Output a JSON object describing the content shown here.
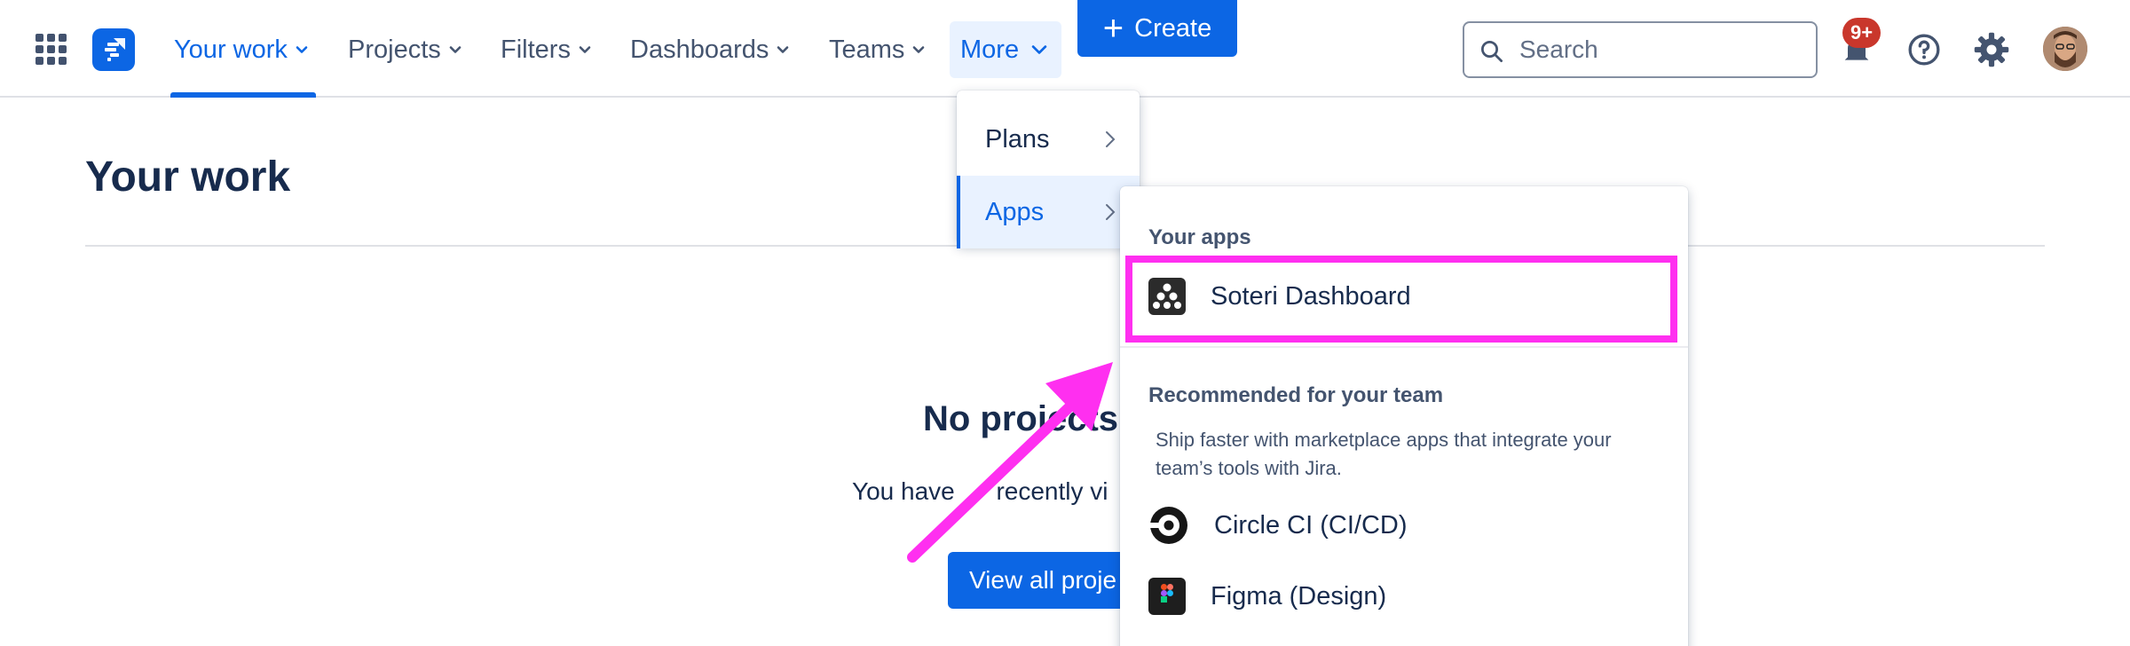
{
  "nav": {
    "your_work": "Your work",
    "projects": "Projects",
    "filters": "Filters",
    "dashboards": "Dashboards",
    "teams": "Teams",
    "more": "More",
    "create": "Create",
    "create_icon": "plus-icon"
  },
  "search": {
    "placeholder": "Search"
  },
  "notifications": {
    "badge": "9+"
  },
  "colors": {
    "brand": "#0c66e4",
    "highlight": "#ff2ff0",
    "badge": "#c9372c"
  },
  "page": {
    "title": "Your work",
    "empty_title": "No projects f",
    "empty_text_a": "You have ",
    "empty_text_b": " recently vi",
    "view_button": "View all proje"
  },
  "more_menu": {
    "items": [
      {
        "label": "Plans"
      },
      {
        "label": "Apps"
      }
    ]
  },
  "apps_menu": {
    "your_apps_heading": "Your apps",
    "your_apps": [
      {
        "label": "Soteri Dashboard",
        "icon": "soteri-icon"
      }
    ],
    "recommended_heading": "Recommended for your team",
    "recommended_text": "Ship faster with marketplace apps that integrate your team’s tools with Jira.",
    "recommended": [
      {
        "label": "Circle CI (CI/CD)",
        "icon": "circleci-icon"
      },
      {
        "label": "Figma (Design)",
        "icon": "figma-icon"
      }
    ]
  }
}
